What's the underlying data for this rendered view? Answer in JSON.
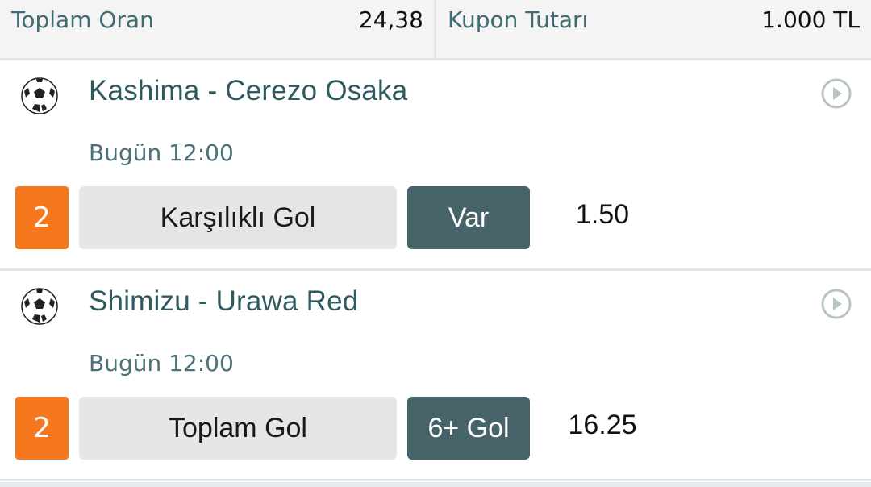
{
  "summary": {
    "total_odds_label": "Toplam Oran",
    "total_odds_value": "24,38",
    "coupon_amount_label": "Kupon Tutarı",
    "coupon_amount_value": "1.000 TL"
  },
  "matches": [
    {
      "teams": "Kashima - Cerezo Osaka",
      "time": "Bugün 12:00",
      "badge": "2",
      "market": "Karşılıklı Gol",
      "selection": "Var",
      "odds": "1.50",
      "icon": "soccer-ball-icon"
    },
    {
      "teams": "Shimizu - Urawa Red",
      "time": "Bugün 12:00",
      "badge": "2",
      "market": "Toplam Gol",
      "selection": "6+ Gol",
      "odds": "16.25",
      "icon": "soccer-ball-icon"
    }
  ],
  "colors": {
    "accent_orange": "#f5781e",
    "selection_bg": "#46636a",
    "team_text": "#2f5a60"
  }
}
